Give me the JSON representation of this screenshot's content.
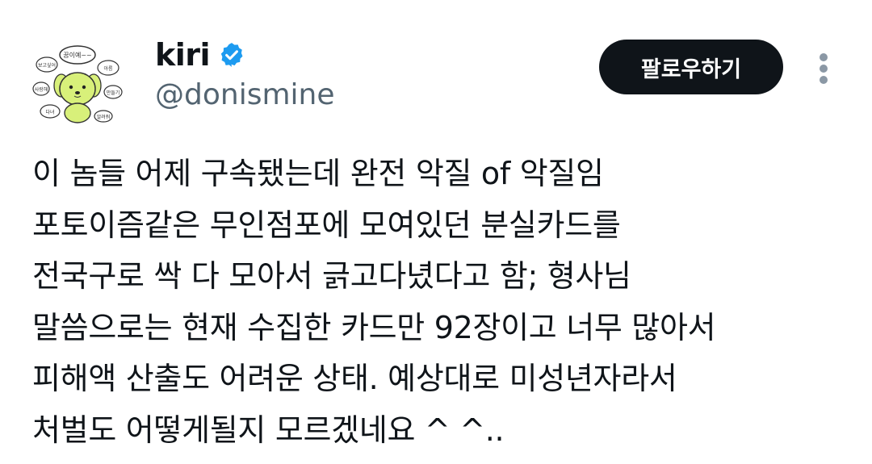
{
  "user": {
    "display_name": "kiri",
    "handle": "@donismine",
    "verified_icon": "verified-badge-icon",
    "avatar_icon": "avatar-doodle-icon",
    "avatar_text": [
      "꿈이예~~",
      "보고싶어",
      "아름",
      "사랑해",
      "만들기",
      "다녀",
      "알려줘"
    ]
  },
  "actions": {
    "follow_label": "팔로우하기",
    "more_icon": "more-vertical-icon"
  },
  "tweet": {
    "lines": [
      "이 놈들 어제 구속됐는데 완전 악질 of 악질임",
      "포토이즘같은 무인점포에 모여있던 분실카드를",
      "전국구로 싹 다 모아서 긁고다녔다고 함; 형사님",
      "말씀으로는 현재 수집한 카드만 92장이고 너무 많아서",
      "피해액 산출도 어려운 상태. 예상대로 미성년자라서",
      "처벌도 어떻게될지 모르겠네요 ^ ^.."
    ]
  },
  "colors": {
    "text": "#0f1419",
    "secondary": "#536471",
    "button_bg": "#0f1419",
    "verified": "#1d9bf0",
    "avatar_character": "#d8f07a"
  }
}
